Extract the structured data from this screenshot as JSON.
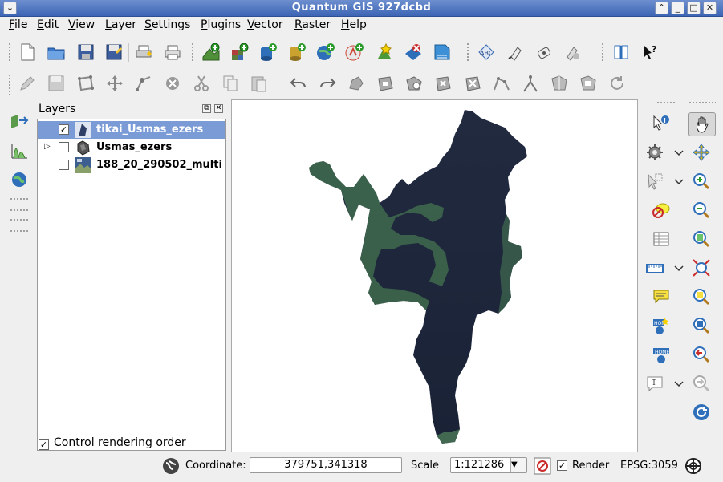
{
  "window": {
    "title": "Quantum GIS 927dcbd"
  },
  "menu": {
    "items": [
      "File",
      "Edit",
      "View",
      "Layer",
      "Settings",
      "Plugins",
      "Vector",
      "Raster",
      "Help"
    ]
  },
  "layers_panel": {
    "title": "Layers",
    "layers": [
      {
        "name": "tikai_Usmas_ezers",
        "checked": true,
        "selected": true
      },
      {
        "name": "Usmas_ezers",
        "checked": false,
        "selected": false,
        "expandable": true
      },
      {
        "name": "188_20_290502_multi",
        "checked": false,
        "selected": false
      }
    ],
    "control_rendering_order_label": "Control rendering order",
    "control_rendering_order_checked": true
  },
  "status": {
    "coordinate_label": "Coordinate:",
    "coordinate_value": "379751,341318",
    "scale_label": "Scale",
    "scale_value": "1:121286",
    "render_label": "Render",
    "render_checked": true,
    "crs": "EPSG:3059"
  },
  "colors": {
    "titlebar": "#3c65b4",
    "selection": "#7a9bd6",
    "lake_dark": "#1d2438",
    "shore_green": "#3f6b4e"
  }
}
